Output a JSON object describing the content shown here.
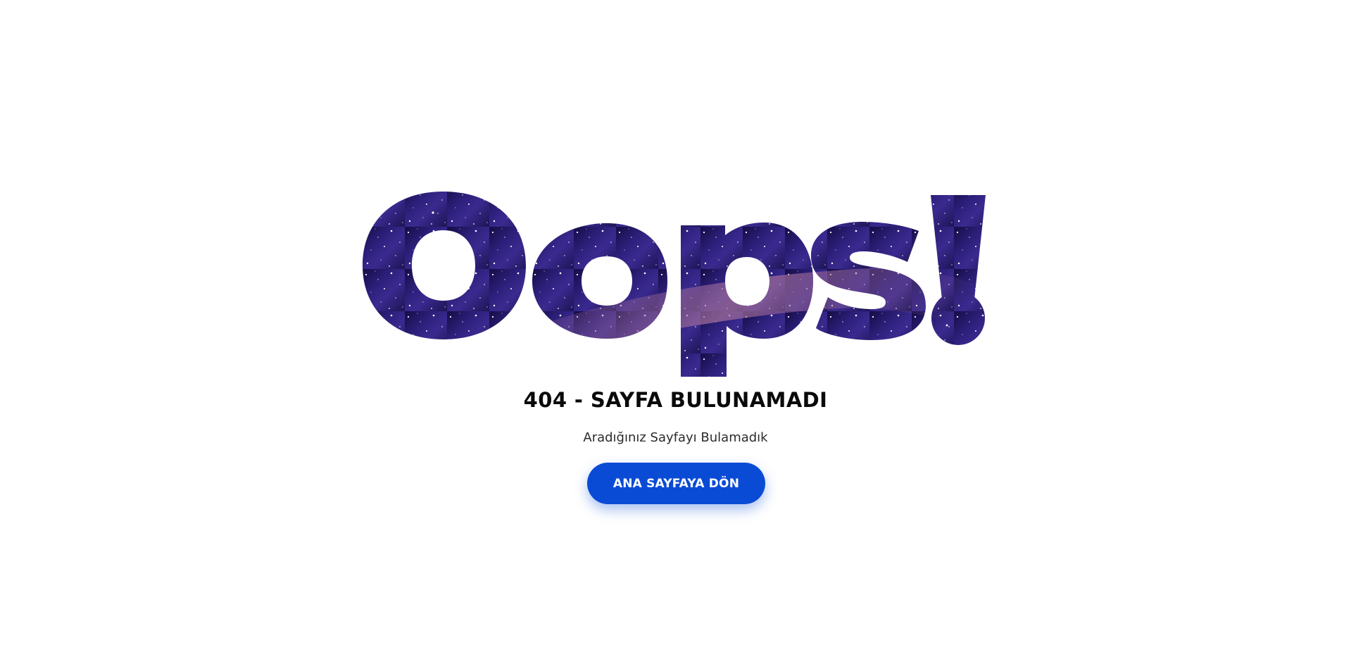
{
  "hero": {
    "headline": "Oops!"
  },
  "error": {
    "title": "404 - SAYFA BULUNAMADI",
    "subtitle": "Aradığınız Sayfayı Bulamadık"
  },
  "actions": {
    "home_button_label": "ANA SAYFAYA DÖN"
  },
  "colors": {
    "accent": "#0a4bd6",
    "headline_space_dark": "#1b1250",
    "headline_space_mid": "#3a2a8f",
    "headline_nebula": "#8a5a8f"
  }
}
